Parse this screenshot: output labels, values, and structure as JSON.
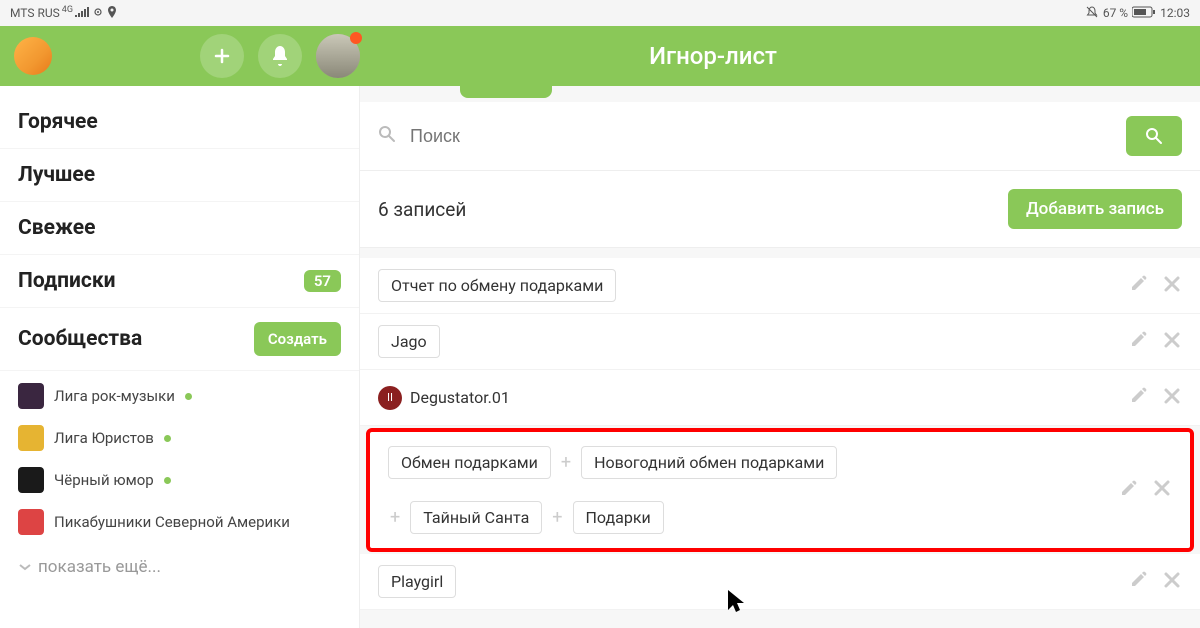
{
  "status": {
    "carrier": "MTS RUS",
    "net_superscript": "4G",
    "battery_pct": "67 %",
    "time": "12:03"
  },
  "header": {
    "title": "Игнор-лист"
  },
  "sidebar": {
    "hot": "Горячее",
    "best": "Лучшее",
    "fresh": "Свежее",
    "subs": "Подписки",
    "subs_count": "57",
    "communities": "Сообщества",
    "create": "Создать",
    "items": [
      {
        "name": "Лига рок-музыки",
        "online": true,
        "thumb": "#3a2640"
      },
      {
        "name": "Лига Юристов",
        "online": true,
        "thumb": "#e6b432"
      },
      {
        "name": "Чёрный юмор",
        "online": true,
        "thumb": "#1a1a1a"
      },
      {
        "name": "Пикабушники Северной Америки",
        "online": false,
        "thumb": "#d44"
      }
    ],
    "show_more": "показать ещё..."
  },
  "main": {
    "search_placeholder": "Поиск",
    "count_text": "6 записей",
    "add_button": "Добавить запись",
    "entries": [
      {
        "type": "tag",
        "tags": [
          "Отчет по обмену подарками"
        ]
      },
      {
        "type": "tag",
        "tags": [
          "Jago"
        ]
      },
      {
        "type": "user",
        "user": "Degustator.01"
      },
      {
        "type": "tag-group",
        "highlight": true,
        "tags": [
          "Обмен подарками",
          "Новогодний обмен подарками",
          "Тайный Санта",
          "Подарки"
        ]
      },
      {
        "type": "tag",
        "tags": [
          "Playgirl"
        ]
      }
    ]
  }
}
